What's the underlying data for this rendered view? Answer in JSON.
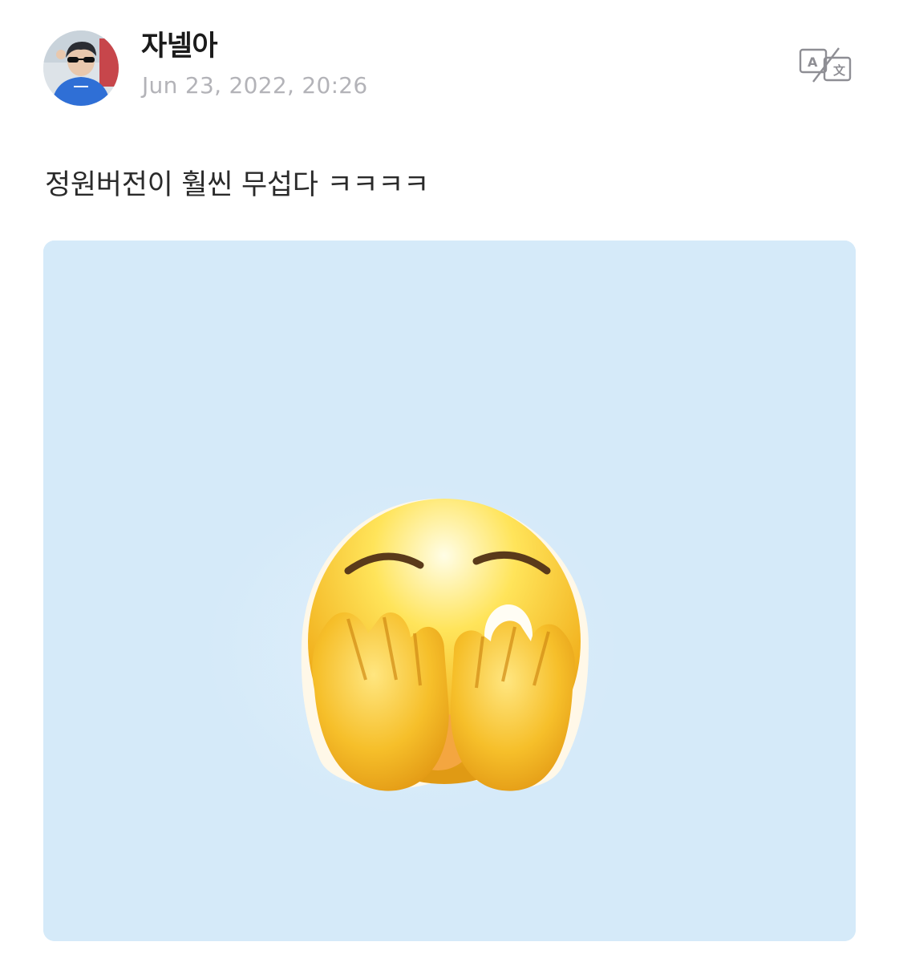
{
  "post": {
    "author": {
      "name": "자넬아",
      "avatar_icon": "profile-photo"
    },
    "timestamp": "Jun 23, 2022, 20:26",
    "translate_icon": "translate-icon",
    "text": "정원버전이 훨씬 무섭다 ㅋㅋㅋㅋ",
    "media": {
      "emoji_icon": "face-with-hands-over-eyes-emoji",
      "background_color": "#d5eaf9"
    }
  }
}
